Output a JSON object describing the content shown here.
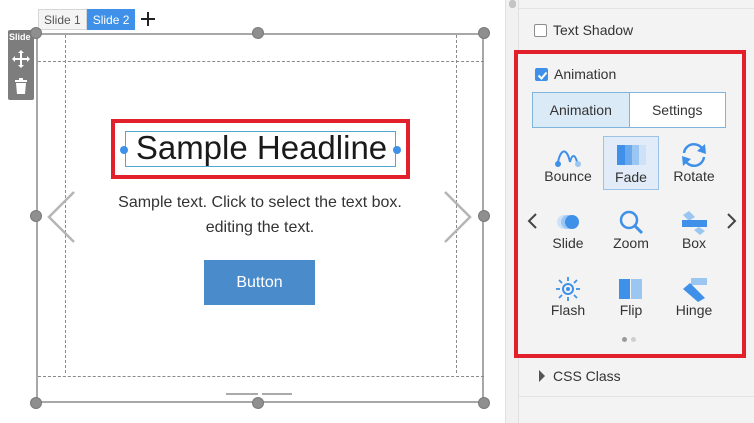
{
  "slides": {
    "tabs": [
      {
        "label": "Slide 1",
        "active": false
      },
      {
        "label": "Slide 2",
        "active": true
      }
    ],
    "add_icon": "plus-icon"
  },
  "side_tools": {
    "label": "Slide",
    "icons": [
      "move-icon",
      "trash-icon"
    ]
  },
  "slide_content": {
    "headline": "Sample Headline",
    "body_line1": "Sample text. Click to select the text box.",
    "body_line2": "editing the text.",
    "button_label": "Button",
    "nav_icons": [
      "chevron-left-icon",
      "chevron-right-icon"
    ]
  },
  "panel": {
    "text_shadow": {
      "label": "Text Shadow",
      "checked": false
    },
    "animation": {
      "label": "Animation",
      "checked": true,
      "tabs": [
        {
          "label": "Animation",
          "active": true
        },
        {
          "label": "Settings",
          "active": false
        }
      ],
      "effects": [
        {
          "label": "Bounce",
          "icon": "bounce-icon",
          "selected": false
        },
        {
          "label": "Fade",
          "icon": "fade-icon",
          "selected": true
        },
        {
          "label": "Rotate",
          "icon": "rotate-icon",
          "selected": false
        },
        {
          "label": "Slide",
          "icon": "slide-icon",
          "selected": false
        },
        {
          "label": "Zoom",
          "icon": "zoom-icon",
          "selected": false
        },
        {
          "label": "Box",
          "icon": "box-icon",
          "selected": false
        },
        {
          "label": "Flash",
          "icon": "flash-icon",
          "selected": false
        },
        {
          "label": "Flip",
          "icon": "flip-icon",
          "selected": false
        },
        {
          "label": "Hinge",
          "icon": "hinge-icon",
          "selected": false
        }
      ],
      "page_indicator": {
        "current": 1,
        "total": 2
      }
    },
    "css_class": {
      "label": "CSS Class",
      "expanded": false
    }
  },
  "colors": {
    "accent": "#3f90e8",
    "highlight_border": "#e2202b",
    "cta_button": "#4a8bcc",
    "panel_background": "#f3f3f3"
  }
}
